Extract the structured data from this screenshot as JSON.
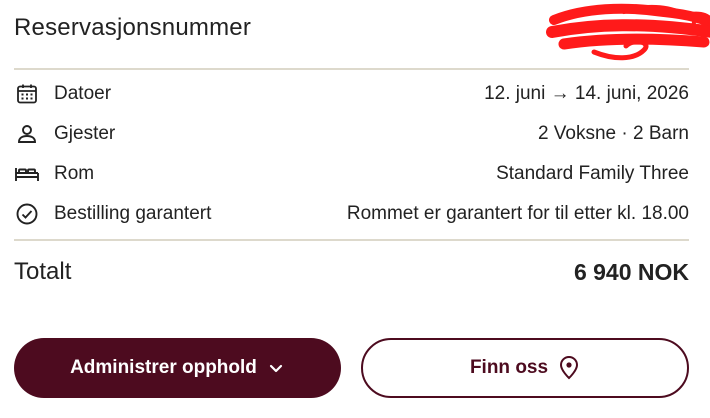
{
  "header": {
    "title": "Reservasjonsnummer"
  },
  "details": [
    {
      "icon": "calendar-icon",
      "label": "Datoer",
      "value": "12. juni → 14. juni, 2026"
    },
    {
      "icon": "person-icon",
      "label": "Gjester",
      "value": "2 Voksne · 2 Barn"
    },
    {
      "icon": "bed-icon",
      "label": "Rom",
      "value": "Standard Family Three"
    },
    {
      "icon": "check-circle-icon",
      "label": "Bestilling garantert",
      "value": "Rommet er garantert for til etter kl. 18.00"
    }
  ],
  "total": {
    "label": "Totalt",
    "value": "6 940 NOK"
  },
  "actions": {
    "manage_label": "Administrer opphold",
    "find_label": "Finn oss"
  },
  "colors": {
    "brand": "#4d0b1f",
    "divider": "#ddd9cc",
    "redaction": "#ff1a1a"
  }
}
